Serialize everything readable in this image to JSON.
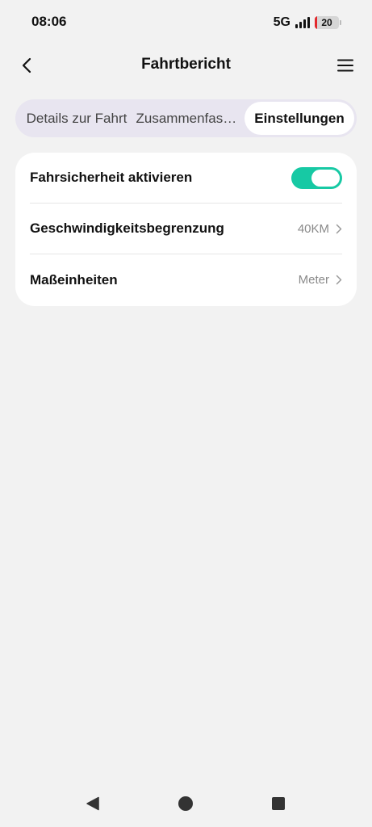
{
  "status_bar": {
    "time": "08:06",
    "network": "5G",
    "battery_level": "20",
    "battery_fraction": 0.2,
    "battery_color": "#e3282c"
  },
  "header": {
    "title": "Fahrtbericht",
    "back_icon": "chevron-left-icon",
    "menu_icon": "hamburger-menu-icon"
  },
  "tabs": [
    {
      "label": "Details zur Fahrt",
      "active": false
    },
    {
      "label": "Zusammenfassung",
      "active": false
    },
    {
      "label": "Einstellungen",
      "active": true
    }
  ],
  "settings": {
    "safety": {
      "label": "Fahrsicherheit aktivieren",
      "enabled": true
    },
    "speed_limit": {
      "label": "Geschwindigkeitsbegrenzung",
      "value": "40KM"
    },
    "units": {
      "label": "Maßeinheiten",
      "value": "Meter"
    }
  },
  "colors": {
    "accent": "#17c9a4",
    "tabs_background": "#e8e5f0",
    "page_background": "#f2f2f2"
  },
  "nav_bar": {
    "back_icon": "triangle-back-icon",
    "home_icon": "circle-home-icon",
    "recent_icon": "square-recent-icon"
  }
}
